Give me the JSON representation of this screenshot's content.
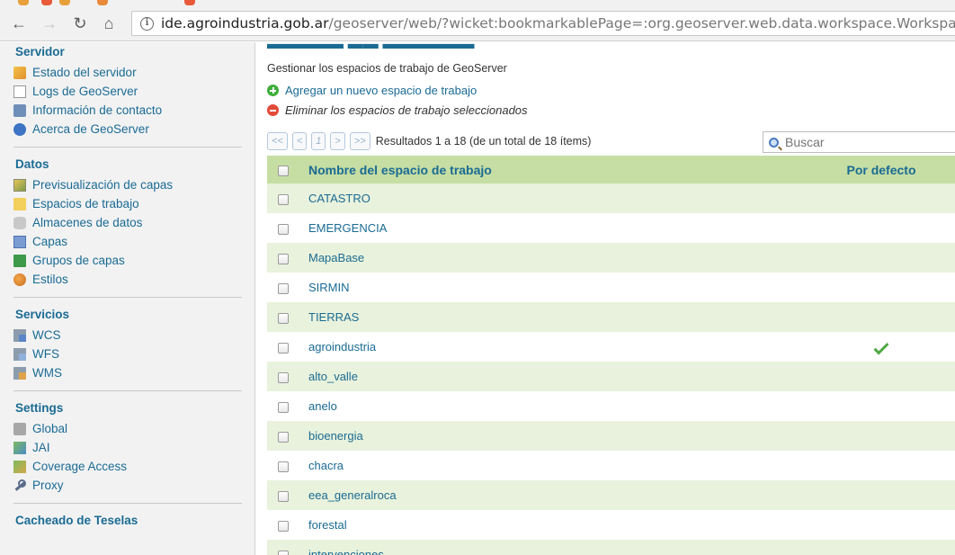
{
  "browser": {
    "url_host": "ide.agroindustria.gob.ar",
    "url_path": "/geoserver/web/?wicket:bookmarkablePage=:org.geoserver.web.data.workspace.WorkspacePag"
  },
  "sidebar": {
    "sections": [
      {
        "title": "Servidor",
        "items": [
          {
            "label": "Estado del servidor",
            "icon": "server-status-icon"
          },
          {
            "label": "Logs de GeoServer",
            "icon": "log-file-icon"
          },
          {
            "label": "Información de contacto",
            "icon": "contact-card-icon"
          },
          {
            "label": "Acerca de GeoServer",
            "icon": "globe-icon"
          }
        ]
      },
      {
        "title": "Datos",
        "items": [
          {
            "label": "Previsualización de capas",
            "icon": "map-preview-icon"
          },
          {
            "label": "Espacios de trabajo",
            "icon": "folder-icon"
          },
          {
            "label": "Almacenes de datos",
            "icon": "database-icon"
          },
          {
            "label": "Capas",
            "icon": "layer-icon"
          },
          {
            "label": "Grupos de capas",
            "icon": "layer-group-icon"
          },
          {
            "label": "Estilos",
            "icon": "palette-icon"
          }
        ]
      },
      {
        "title": "Servicios",
        "items": [
          {
            "label": "WCS",
            "icon": "wcs-service-icon"
          },
          {
            "label": "WFS",
            "icon": "wfs-service-icon"
          },
          {
            "label": "WMS",
            "icon": "wms-service-icon"
          }
        ]
      },
      {
        "title": "Settings",
        "items": [
          {
            "label": "Global",
            "icon": "server-settings-icon"
          },
          {
            "label": "JAI",
            "icon": "jai-icon"
          },
          {
            "label": "Coverage Access",
            "icon": "coverage-icon"
          },
          {
            "label": "Proxy",
            "icon": "wrench-icon"
          }
        ]
      },
      {
        "title": "Cacheado de Teselas",
        "items": []
      }
    ]
  },
  "main": {
    "description": "Gestionar los espacios de trabajo de GeoServer",
    "add_label": "Agregar un nuevo espacio de trabajo",
    "remove_label": "Eliminar los espacios de trabajo seleccionados",
    "pager": {
      "first": "<<",
      "prev": "<",
      "page": "1",
      "next": ">",
      "last": ">>",
      "results": "Resultados 1 a 18 (de un total de 18 ítems)"
    },
    "search_placeholder": "Buscar",
    "table": {
      "col_name": "Nombre del espacio de trabajo",
      "col_default": "Por defecto",
      "rows": [
        {
          "name": "CATASTRO",
          "default": false
        },
        {
          "name": "EMERGENCIA",
          "default": false
        },
        {
          "name": "MapaBase",
          "default": false
        },
        {
          "name": "SIRMIN",
          "default": false
        },
        {
          "name": "TIERRAS",
          "default": false
        },
        {
          "name": "agroindustria",
          "default": true
        },
        {
          "name": "alto_valle",
          "default": false
        },
        {
          "name": "anelo",
          "default": false
        },
        {
          "name": "bioenergia",
          "default": false
        },
        {
          "name": "chacra",
          "default": false
        },
        {
          "name": "eea_generalroca",
          "default": false
        },
        {
          "name": "forestal",
          "default": false
        },
        {
          "name": "intervenciones",
          "default": false
        }
      ]
    }
  },
  "colors": {
    "link": "#1a6b94",
    "header_bg": "#c6dea3",
    "row_alt_bg": "#e9f2dc",
    "default_check": "#4fa844"
  }
}
